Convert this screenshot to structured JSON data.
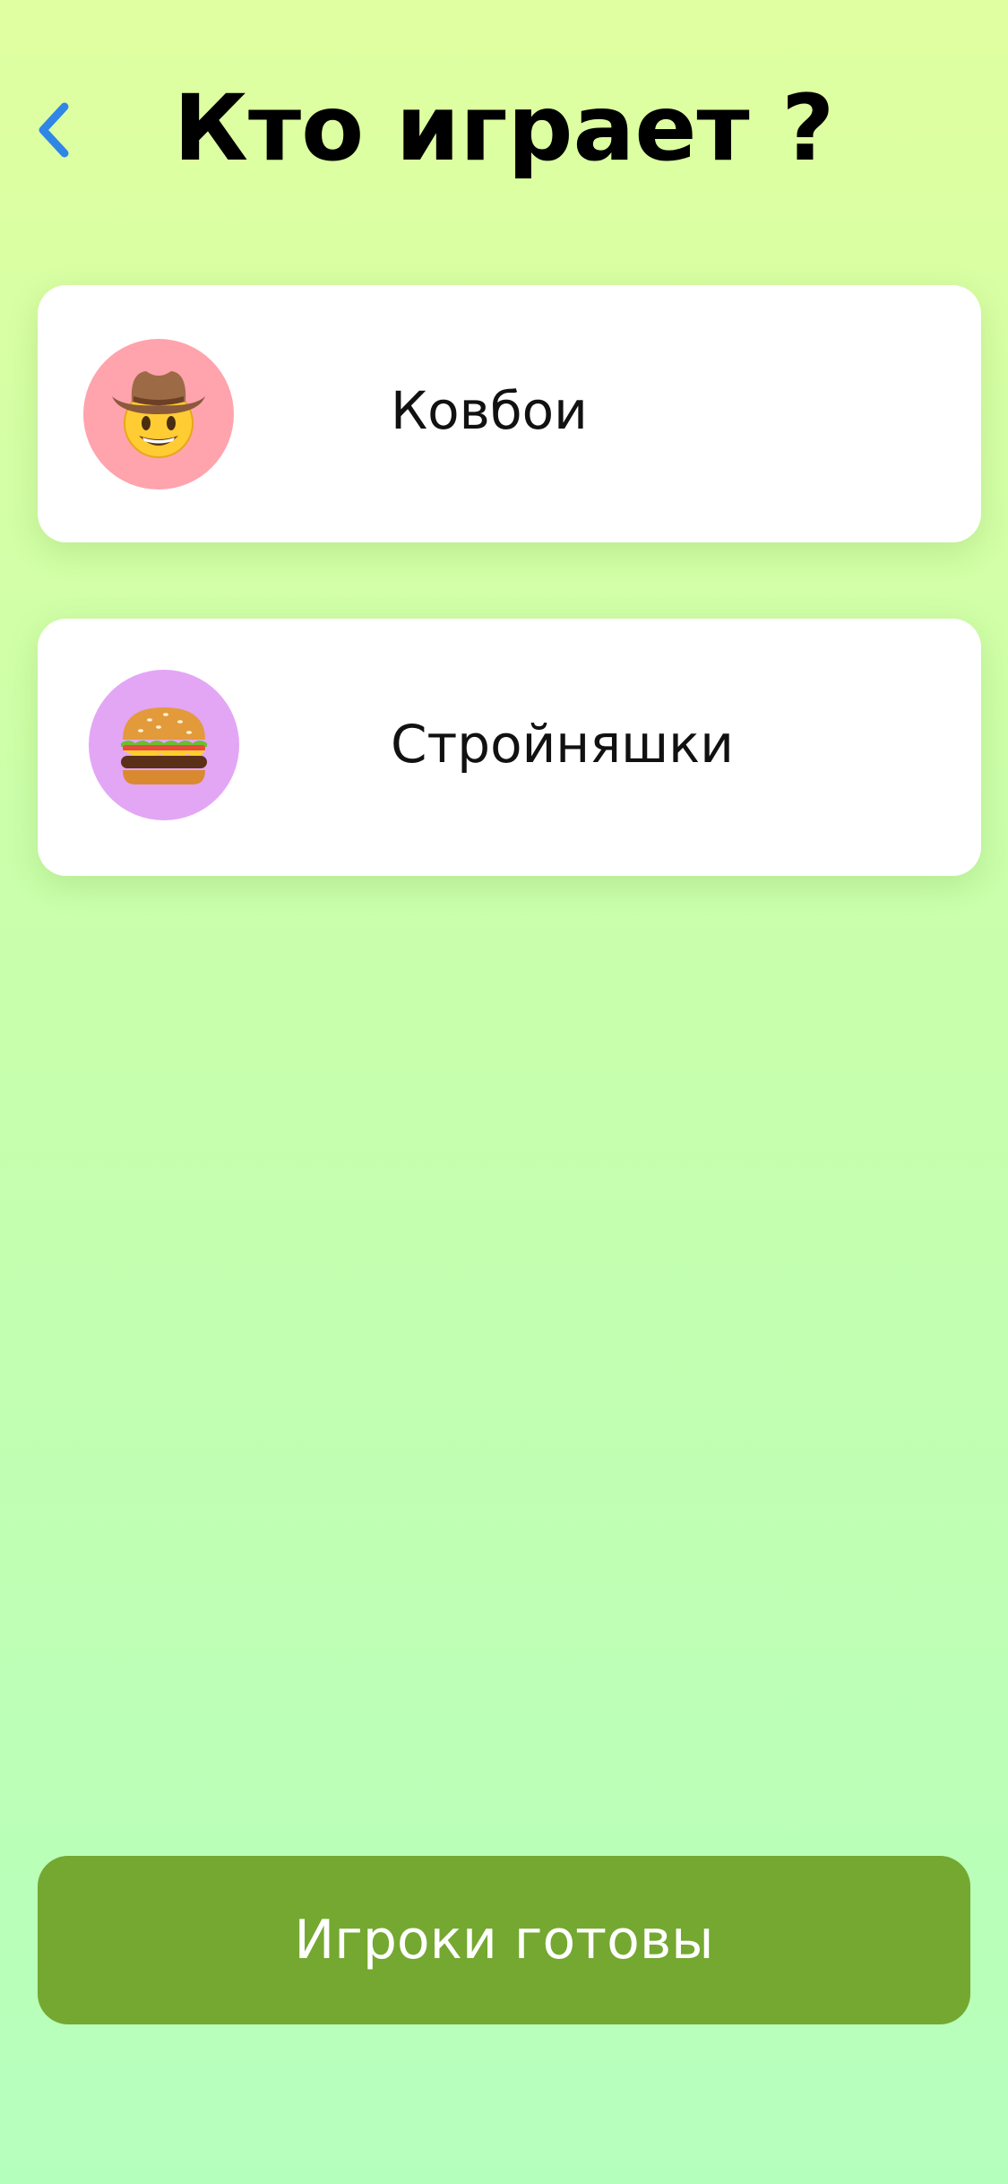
{
  "header": {
    "title": "Кто играет ?",
    "back_icon": "chevron-left-icon",
    "accent_color": "#2f86e6"
  },
  "teams": [
    {
      "name": "Ковбои",
      "icon": "cowboy-face-icon",
      "avatar_color": "#ffa3ad"
    },
    {
      "name": "Стройняшки",
      "icon": "hamburger-icon",
      "avatar_color": "#e3a6f5"
    }
  ],
  "footer": {
    "ready_label": "Игроки готовы",
    "button_color": "#74a830"
  },
  "background": {
    "top_color": "#e0ffa0",
    "bottom_color": "#b5ffbd"
  }
}
